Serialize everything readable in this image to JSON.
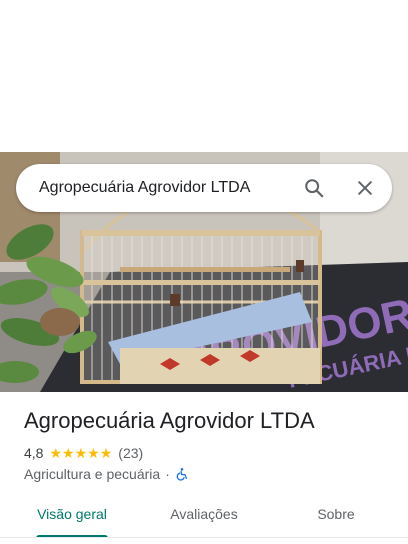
{
  "search": {
    "query": "Agropecuária Agrovidor LTDA"
  },
  "hero": {
    "mat_text_line1": "AGROVIDOR",
    "mat_text_line2": "PECUÁRIA E"
  },
  "place": {
    "name": "Agropecuária Agrovidor LTDA",
    "rating": "4,8",
    "stars_filled": 5,
    "review_count": "(23)",
    "category": "Agricultura e pecuária",
    "separator": "·"
  },
  "tabs": [
    {
      "label": "Visão geral",
      "active": true
    },
    {
      "label": "Avaliações",
      "active": false
    },
    {
      "label": "Sobre",
      "active": false
    }
  ],
  "colors": {
    "accent": "#00796b",
    "star": "#fbbc04",
    "wheelchair": "#1a73e8"
  },
  "icons": {
    "search": "search-icon",
    "close": "close-icon",
    "accessibility": "wheelchair-icon"
  }
}
